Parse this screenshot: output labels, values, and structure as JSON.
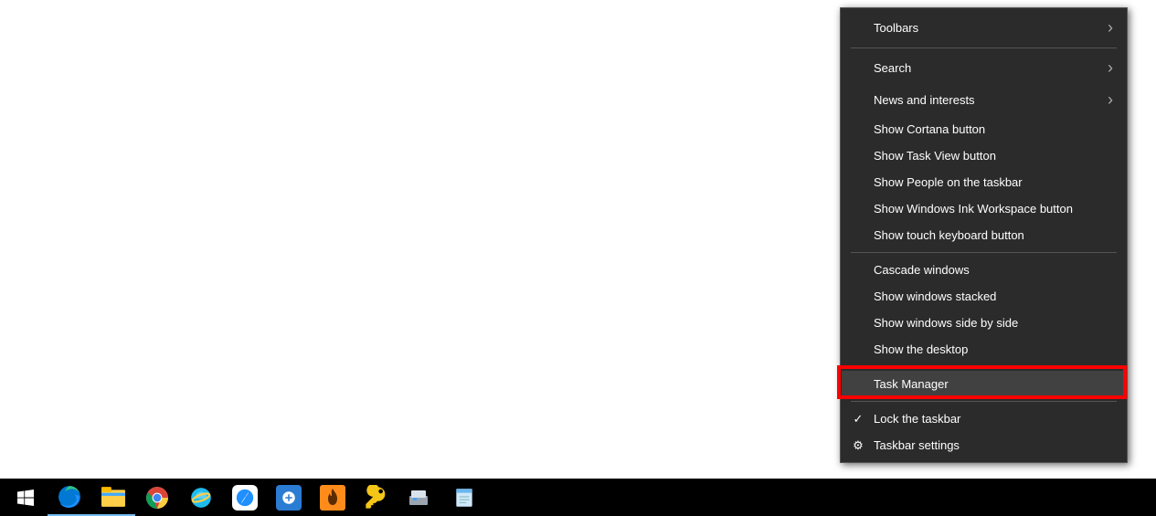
{
  "context_menu": {
    "items": [
      {
        "label": "Toolbars",
        "has_submenu": true
      },
      {
        "separator": true
      },
      {
        "label": "Search",
        "has_submenu": true
      },
      {
        "label": "News and interests",
        "has_submenu": true
      },
      {
        "label": "Show Cortana button"
      },
      {
        "label": "Show Task View button"
      },
      {
        "label": "Show People on the taskbar"
      },
      {
        "label": "Show Windows Ink Workspace button"
      },
      {
        "label": "Show touch keyboard button"
      },
      {
        "separator": true
      },
      {
        "label": "Cascade windows"
      },
      {
        "label": "Show windows stacked"
      },
      {
        "label": "Show windows side by side"
      },
      {
        "label": "Show the desktop"
      },
      {
        "separator": true
      },
      {
        "label": "Task Manager",
        "highlighted": true,
        "hover": true
      },
      {
        "separator": true
      },
      {
        "label": "Lock the taskbar",
        "icon": "check"
      },
      {
        "label": "Taskbar settings",
        "icon": "gear"
      }
    ]
  },
  "taskbar": {
    "items": [
      {
        "name": "start-button",
        "type": "windows"
      },
      {
        "name": "edge-browser",
        "type": "edge",
        "active": true
      },
      {
        "name": "file-explorer",
        "type": "explorer",
        "active": true
      },
      {
        "name": "chrome-browser",
        "type": "chrome"
      },
      {
        "name": "internet-explorer",
        "type": "ie"
      },
      {
        "name": "safari-browser",
        "type": "safari"
      },
      {
        "name": "app-plus",
        "type": "plus"
      },
      {
        "name": "app-flame",
        "type": "flame"
      },
      {
        "name": "app-key",
        "type": "key"
      },
      {
        "name": "app-scanner",
        "type": "scanner"
      },
      {
        "name": "app-notepad",
        "type": "notepad"
      }
    ]
  }
}
